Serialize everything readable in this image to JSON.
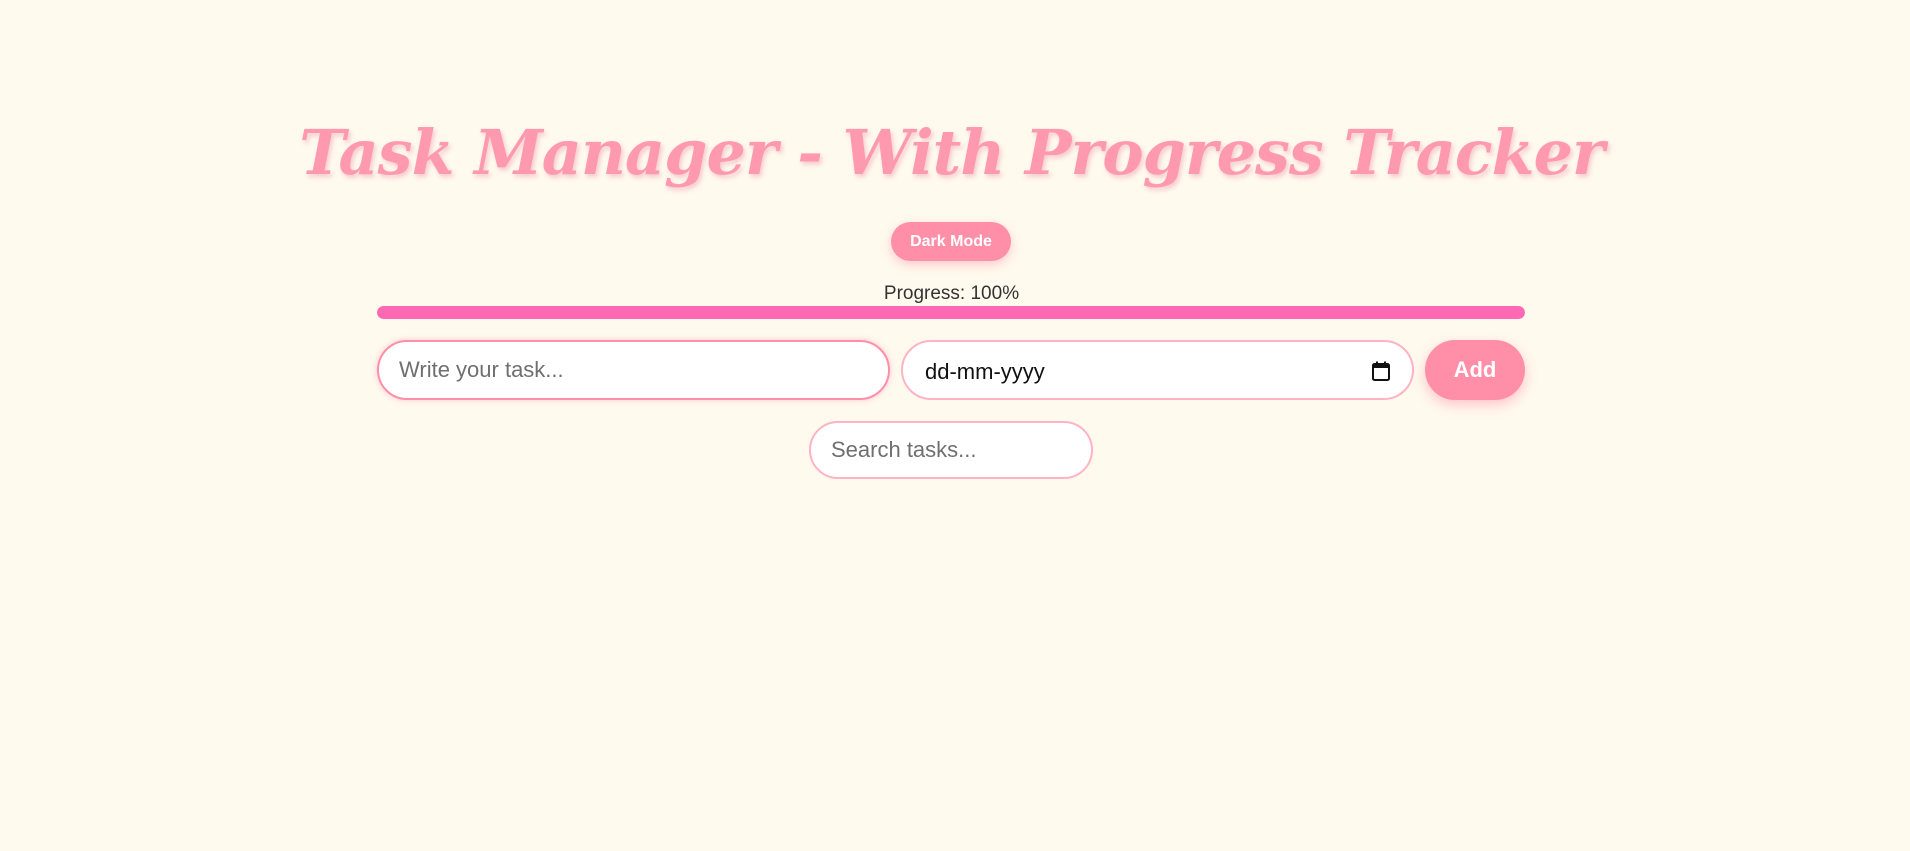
{
  "app": {
    "title": "Task Manager - With Progress Tracker"
  },
  "controls": {
    "dark_mode_label": "Dark Mode",
    "add_label": "Add"
  },
  "progress": {
    "label": "Progress: 100%",
    "value": 1.0
  },
  "task_form": {
    "task_placeholder": "Write your task...",
    "task_value": "",
    "date_value": "dd-mm-yyyy"
  },
  "search": {
    "placeholder": "Search tasks...",
    "value": ""
  },
  "colors": {
    "background": "#fff9ee",
    "accent": "#ff8fa8",
    "progress_fill": "#ff69b4"
  },
  "icons": {
    "date_picker": "calendar-icon"
  }
}
